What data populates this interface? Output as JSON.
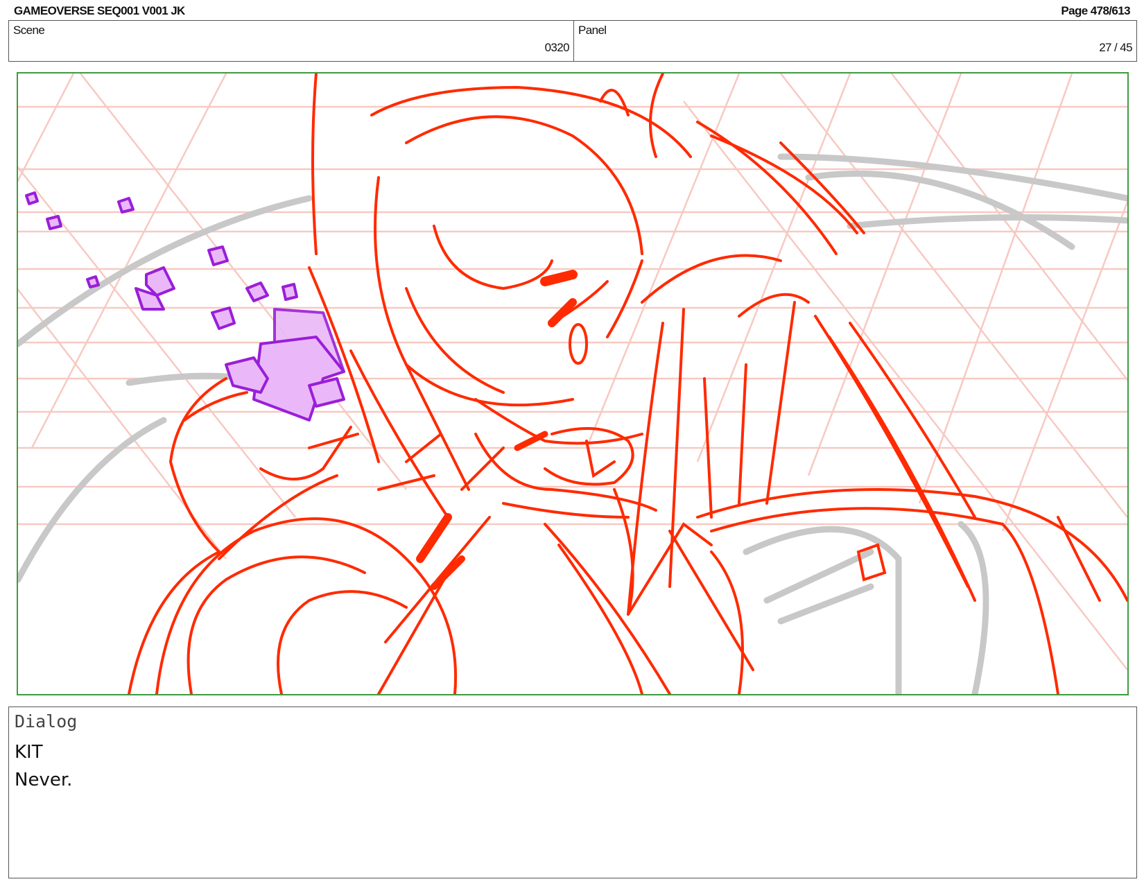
{
  "header": {
    "title": "GAMEOVERSE SEQ001 V001 JK",
    "page": "Page 478/613"
  },
  "info": {
    "scene_label": "Scene",
    "scene_value": "0320",
    "panel_label": "Panel",
    "panel_value": "27 / 45"
  },
  "panel_image": {
    "description_icon": "storyboard-sketch",
    "colors": {
      "sketch": "#ff2a00",
      "grid": "#f7c9c2",
      "guides": "#c8c8c8",
      "cubes": "#9a1ed8",
      "cube_fill": "#eab8f8",
      "frame_border": "#3f9a3f"
    }
  },
  "dialog": {
    "label": "Dialog",
    "character": "KIT",
    "line": "Never."
  }
}
